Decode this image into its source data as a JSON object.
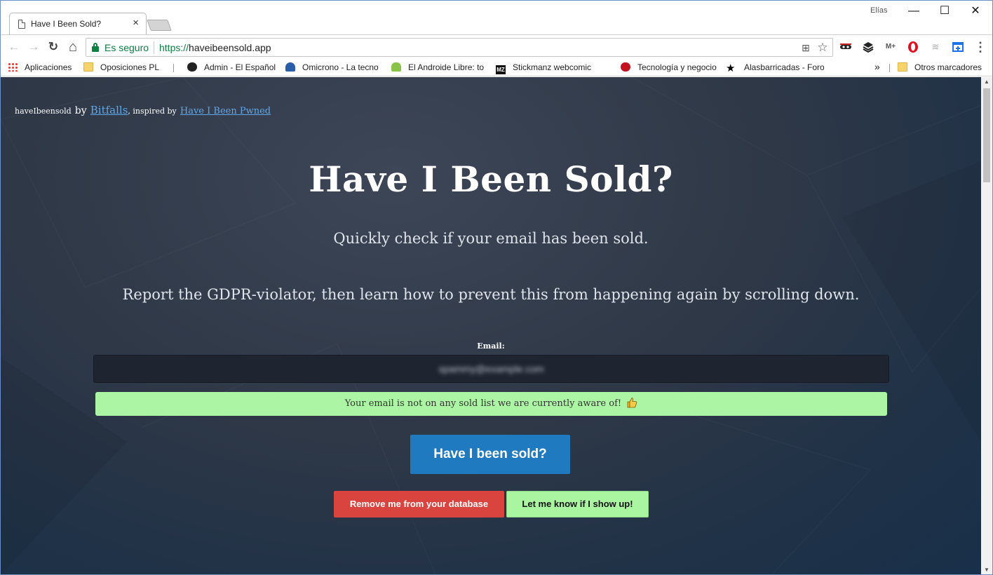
{
  "browser": {
    "tab_title": "Have I Been Sold?",
    "tab_close": "×",
    "profile_name": "Elías",
    "window_controls": {
      "minimize": "—",
      "maximize": "☐",
      "close": "✕"
    },
    "nav": {
      "back": "←",
      "forward": "→",
      "reload": "↻",
      "home": "⌂"
    },
    "security_label": "Es seguro",
    "url_scheme": "https://",
    "url_host": "haveibeensold.app",
    "menu_icon": "⋮",
    "star_icon": "☆",
    "translate_icon": "⊞",
    "extensions": [
      "mask-icon",
      "layers-icon",
      "m-plus-icon",
      "opera-icon",
      "link-icon",
      "window-icon"
    ]
  },
  "bookmarks": {
    "items": [
      {
        "label": "Aplicaciones",
        "icon": "apps-grid-icon"
      },
      {
        "label": "Oposiciones PL",
        "icon": "folder-icon"
      },
      {
        "label": "Admin - El Español",
        "icon": "lion-icon"
      },
      {
        "label": "Omicrono - La tecno",
        "icon": "omicrono-icon"
      },
      {
        "label": "El Androide Libre: to",
        "icon": "android-icon"
      },
      {
        "label": "Stickmanz webcomic",
        "icon": "mz-icon"
      },
      {
        "label": "Tecnología y negocio",
        "icon": "bug-icon"
      },
      {
        "label": "Alasbarricadas - Foro",
        "icon": "star-icon"
      }
    ],
    "overflow": "»",
    "other_label": "Otros marcadores"
  },
  "page": {
    "credit_site": "haveIbeensold",
    "credit_by": "by",
    "credit_author": "Bitfalls",
    "credit_inspired": ", inspired by",
    "credit_source": "Have I Been Pwned",
    "title": "Have I Been Sold?",
    "subtitle": "Quickly check if your email has been sold.",
    "report_text": "Report the GDPR-violator, then learn how to prevent this from happening again by scrolling down.",
    "email_label": "Email:",
    "email_value": "spammy@example.com",
    "alert_text": "Your email is not on any sold list we are currently aware of!",
    "alert_color": "#acf5a4",
    "check_button": "Have I been sold?",
    "check_color": "#1f7ac0",
    "remove_button": "Remove me from your database",
    "remove_color": "#d9443f",
    "notify_button": "Let me know if I show up!",
    "notify_color": "#a9f5a0"
  }
}
